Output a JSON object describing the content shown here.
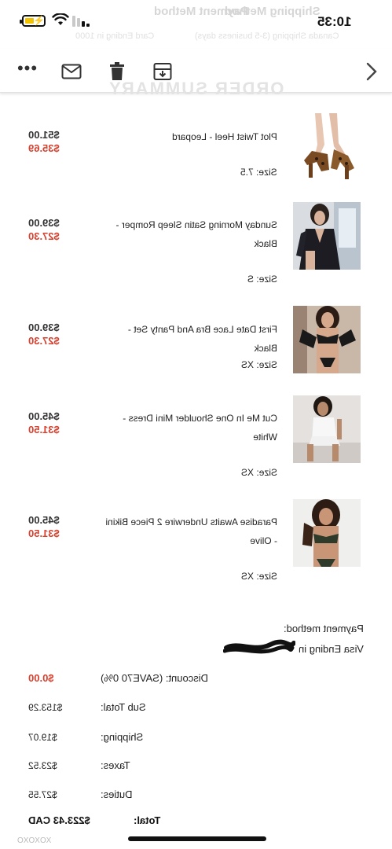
{
  "status_bar": {
    "time": "10:35"
  },
  "ghost_header": {
    "shipping_method": "Shipping Method",
    "payment_method": "Payment Method",
    "shipping_detail": "Canada Shipping (3-5 business days)",
    "payment_detail": "Card Ending in 1000"
  },
  "toolbar": {
    "more": "•••",
    "icons": [
      "more-icon",
      "mail-icon",
      "trash-icon",
      "archive-icon",
      "chevron-right-icon"
    ]
  },
  "order_summary_title": "ORDER SUMMARY",
  "items": [
    {
      "name": "Plot Twist Heel - Leopard",
      "size": "Size: 7.5",
      "price_old": "$51.00",
      "price_new": "$35.69"
    },
    {
      "name": "Sunday Morning Satin Sleep Romper - Black",
      "size": "Size: S",
      "price_old": "$39.00",
      "price_new": "$27.30"
    },
    {
      "name": "First Date Lace Bra And Panty Set - Black",
      "size": "Size: XS",
      "price_old": "$39.00",
      "price_new": "$27.30"
    },
    {
      "name": "Cut Me In One Shoulder Mini Dress - White",
      "size": "Size: XS",
      "price_old": "$45.00",
      "price_new": "$31.50"
    },
    {
      "name": "Paradise Awaits Underwire 2 Piece Bikini - Olive",
      "size": "Size: XS",
      "price_old": "$45.00",
      "price_new": "$31.50"
    }
  ],
  "payment": {
    "label": "Payment method:",
    "visa": "Visa Ending in"
  },
  "summary": {
    "discount_label": "Discount: (SAVE70 0%)",
    "discount_value": "$0.00",
    "subtotal_label": "Sub Total:",
    "subtotal_value": "$153.29",
    "shipping_label": "Shipping:",
    "shipping_value": "$19.07",
    "taxes_label": "Taxes:",
    "taxes_value": "$23.52",
    "duties_label": "Duties:",
    "duties_value": "$27.55",
    "total_label": "Total:",
    "total_value": "$223.43 CAD"
  },
  "footer": {
    "signoff": "XOXOXO"
  },
  "colors": {
    "sale_red": "#d6412f",
    "battery_yellow": "#f2c200",
    "text_dark": "#222222"
  }
}
